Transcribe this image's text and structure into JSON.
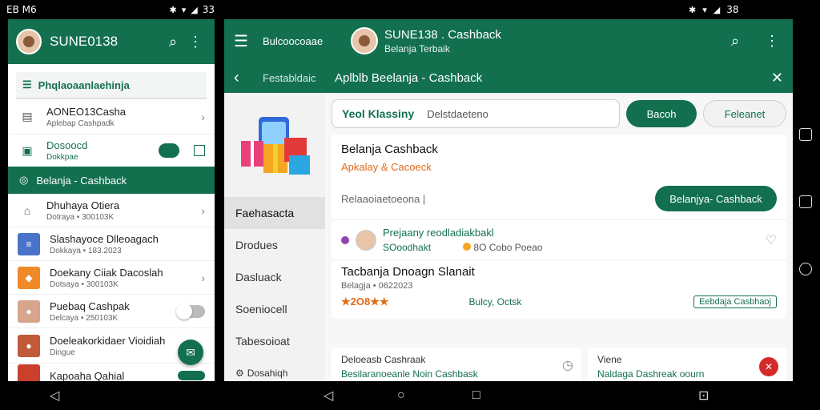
{
  "status_left": {
    "time_text": "EB M6",
    "right": "33"
  },
  "status_right": {
    "time_text": "38"
  },
  "left_panel": {
    "title": "SUNE0138",
    "subbar": "Phqlaoaanlaehinja",
    "rows": [
      {
        "title": "AONEO13Casha",
        "subtitle": "Aplebap Cashpadk"
      },
      {
        "title": "Dosoocd",
        "subtitle": "Dokkpae"
      }
    ],
    "active": "Belanja - Cashback",
    "list": [
      {
        "title": "Dhuhaya Otiera",
        "subtitle": "Dotraya • 300103K",
        "color": "#ffffff"
      },
      {
        "title": "Slashayoce Dlleoagach",
        "subtitle": "Dokkaya • 183.2023",
        "color": "#4a74c9"
      },
      {
        "title": "Doekany Ciiak Dacoslah",
        "subtitle": "Dotsaya • 300103K",
        "color": "#f08a28"
      },
      {
        "title": "Puebaq Cashpak",
        "subtitle": "Delcaya • 250103K",
        "color": "#d6a58b"
      },
      {
        "title": "Doeleakorkidaer Vioidiah",
        "subtitle": "Dingue",
        "color": "#c25a3a"
      },
      {
        "title": "Kapoaha Qahial",
        "subtitle": "",
        "color": "#c9402c"
      }
    ]
  },
  "right_panel": {
    "crumb": "Bulcoocoaae",
    "user_name": "SUNE138 . Cashback",
    "user_sub": "Belanja Terbaik",
    "sub_crumb": "Festabldaic",
    "page_title": "Aplblb Beelanja - Cashback",
    "sidebar": [
      "Faehasacta",
      "Drodues",
      "Dasluack",
      "Soeniocell",
      "Tabesoioat",
      "Dosahiqh"
    ],
    "tabs": {
      "a": "Yeol Klassiny",
      "b": "Delstdaeteno",
      "primary": "Bacoh",
      "outline": "Feleanet"
    },
    "card": {
      "title": "Belanja Cashback",
      "subtitle": "Apkalay & Cacoeck",
      "input": "Relaaoiaetoeona |",
      "button": "Belanjya- Cashback",
      "feed_t1": "Prejaany reodladiakbakl",
      "feed_t2": "SOoodhakt",
      "feed_right": "8O Cobo Poeao",
      "s2_title": "Tacbanja Dnoagn Slanait",
      "s2_sub": "Belagja • 0622023",
      "s2_price": "★2O8★★",
      "s2_mid": "Bulcy, Octsk",
      "badge": "Eebdaja Casbhaoj"
    },
    "bottom": [
      {
        "t1": "Deloeasb Cashraak",
        "t2": "Besilaranoeanle Noin Cashbask"
      },
      {
        "t1": "Viene",
        "t2": "Naldaga Dashreak oourn"
      }
    ]
  }
}
